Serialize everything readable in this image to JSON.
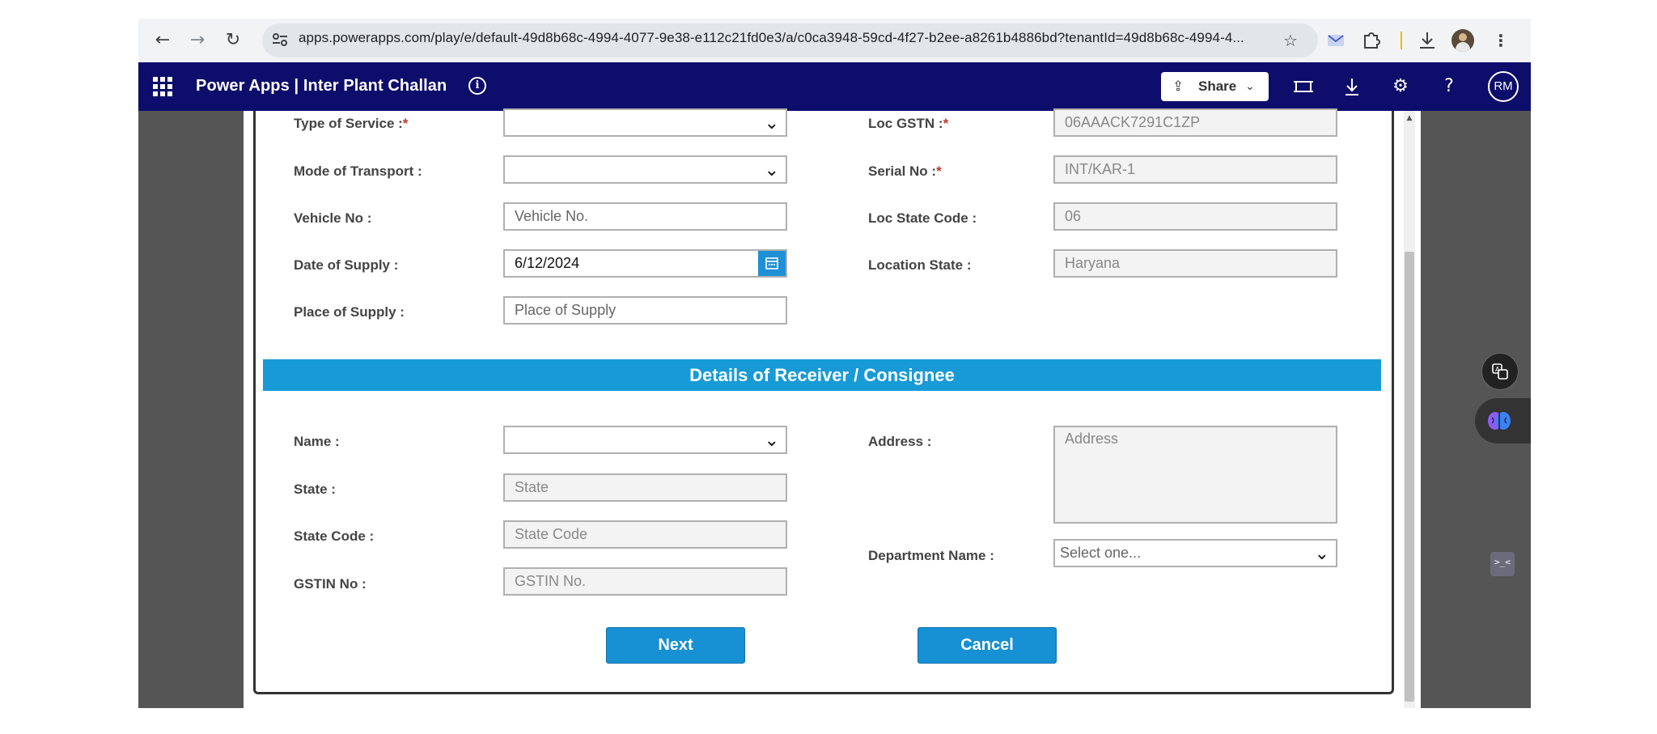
{
  "browser": {
    "url": "apps.powerapps.com/play/e/default-49d8b68c-4994-4077-9e38-e112c21fd0e3/a/c0ca3948-59cd-4f27-b2ee-a8261b4886bd?tenantId=49d8b68c-4994-4..."
  },
  "header": {
    "title": "Power Apps  |  Inter Plant Challan",
    "share_label": "Share",
    "avatar_initials": "RM"
  },
  "form": {
    "left": [
      {
        "label": "Type of Service :",
        "required": "*",
        "type": "dropdown",
        "value": ""
      },
      {
        "label": "Mode of Transport :",
        "required": "",
        "type": "dropdown",
        "value": ""
      },
      {
        "label": "Vehicle No :",
        "required": "",
        "type": "text",
        "placeholder": "Vehicle No."
      },
      {
        "label": "Date of Supply :",
        "required": "",
        "type": "date",
        "value": "6/12/2024"
      },
      {
        "label": "Place of Supply :",
        "required": "",
        "type": "text",
        "placeholder": "Place of Supply"
      }
    ],
    "right": [
      {
        "label": "Loc GSTN :",
        "required": "*",
        "value": "06AAACK7291C1ZP"
      },
      {
        "label": "Serial No :",
        "required": "*",
        "value": "INT/KAR-1"
      },
      {
        "label": "Loc State Code :",
        "required": "",
        "value": "06"
      },
      {
        "label": "Location State :",
        "required": "",
        "value": "Haryana"
      }
    ]
  },
  "receiver": {
    "section_title": "Details of Receiver / Consignee",
    "name_label": "Name :",
    "state_label": "State :",
    "state_placeholder": "State",
    "state_code_label": "State Code :",
    "state_code_placeholder": "State Code",
    "gstin_label": "GSTIN No :",
    "gstin_placeholder": "GSTIN No.",
    "address_label": "Address :",
    "address_placeholder": "Address",
    "department_label": "Department Name :",
    "department_placeholder": "Select one..."
  },
  "actions": {
    "next_label": "Next",
    "cancel_label": "Cancel"
  },
  "colors": {
    "header_bg": "#0d0d6b",
    "accent": "#189ad6",
    "required": "#c0392b"
  }
}
